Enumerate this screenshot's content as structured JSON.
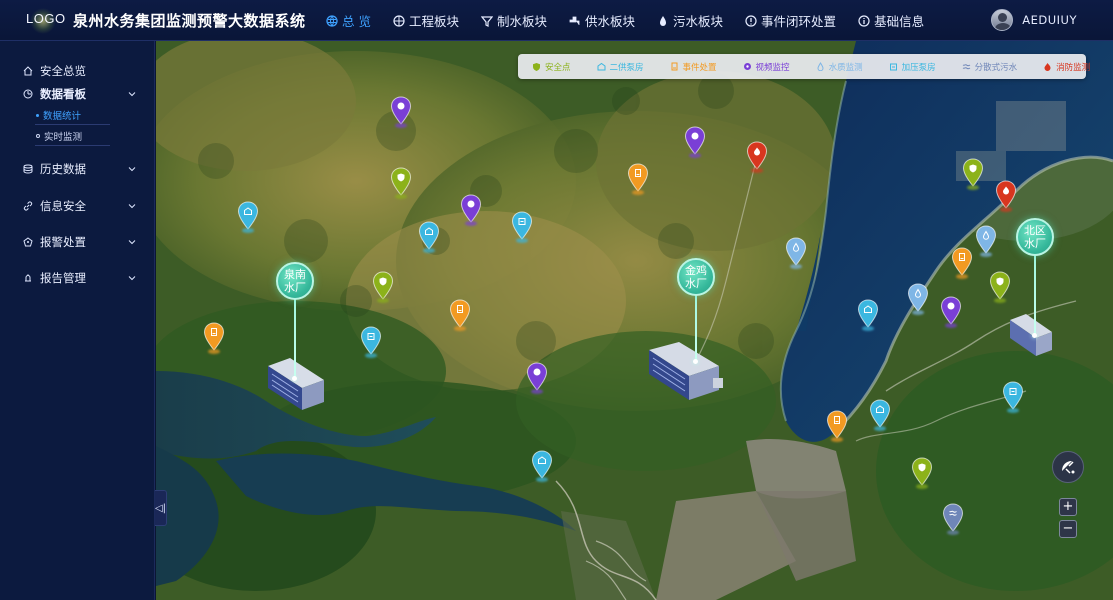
{
  "header": {
    "logo": "LOGO",
    "title": "泉州水务集团监测预警大数据系统",
    "nav": [
      {
        "label": "总 览",
        "icon": "globe-icon",
        "active": true
      },
      {
        "label": "工程板块",
        "icon": "network-icon",
        "active": false
      },
      {
        "label": "制水板块",
        "icon": "filter-icon",
        "active": false
      },
      {
        "label": "供水板块",
        "icon": "faucet-icon",
        "active": false
      },
      {
        "label": "污水板块",
        "icon": "drop-icon",
        "active": false
      },
      {
        "label": "事件闭环处置",
        "icon": "alert-circle-icon",
        "active": false
      },
      {
        "label": "基础信息",
        "icon": "info-icon",
        "active": false
      }
    ],
    "user": {
      "name": "AEDUIUY",
      "avatar": "avatar"
    }
  },
  "sidebar": {
    "items": [
      {
        "label": "安全总览",
        "icon": "home-icon",
        "expandable": false
      },
      {
        "label": "数据看板",
        "icon": "dashboard-icon",
        "expandable": true,
        "expanded": true,
        "children": [
          {
            "label": "数据统计",
            "active": true
          },
          {
            "label": "实时监测",
            "active": false
          }
        ]
      },
      {
        "label": "历史数据",
        "icon": "database-icon",
        "expandable": true
      },
      {
        "label": "信息安全",
        "icon": "link-icon",
        "expandable": true
      },
      {
        "label": "报警处置",
        "icon": "alarm-icon",
        "expandable": true
      },
      {
        "label": "报告管理",
        "icon": "report-icon",
        "expandable": true
      }
    ],
    "collapse_label": "◁|"
  },
  "legend": {
    "items": [
      {
        "label": "安全点",
        "color": "#8cb21a",
        "icon": "shield-icon"
      },
      {
        "label": "二供泵房",
        "color": "#3bb7e0",
        "icon": "pump-house-icon"
      },
      {
        "label": "事件处置",
        "color": "#f29a22",
        "icon": "event-icon"
      },
      {
        "label": "视频监控",
        "color": "#7a3fd6",
        "icon": "camera-icon"
      },
      {
        "label": "水质监测",
        "color": "#7fb6e6",
        "icon": "water-quality-icon"
      },
      {
        "label": "加压泵房",
        "color": "#3bb7e0",
        "icon": "booster-pump-icon"
      },
      {
        "label": "分散式污水",
        "color": "#6f86b8",
        "icon": "sewage-icon"
      },
      {
        "label": "消防监测",
        "color": "#d8361f",
        "icon": "fire-icon"
      }
    ]
  },
  "plants": [
    {
      "name": "泉南水厂",
      "line1": "泉南",
      "line2": "水厂"
    },
    {
      "name": "金鸡水厂",
      "line1": "金鸡",
      "line2": "水厂"
    },
    {
      "name": "北区水厂",
      "line1": "北区",
      "line2": "水厂"
    }
  ],
  "map_controls": {
    "zoom_in": "+",
    "zoom_out": "−"
  }
}
